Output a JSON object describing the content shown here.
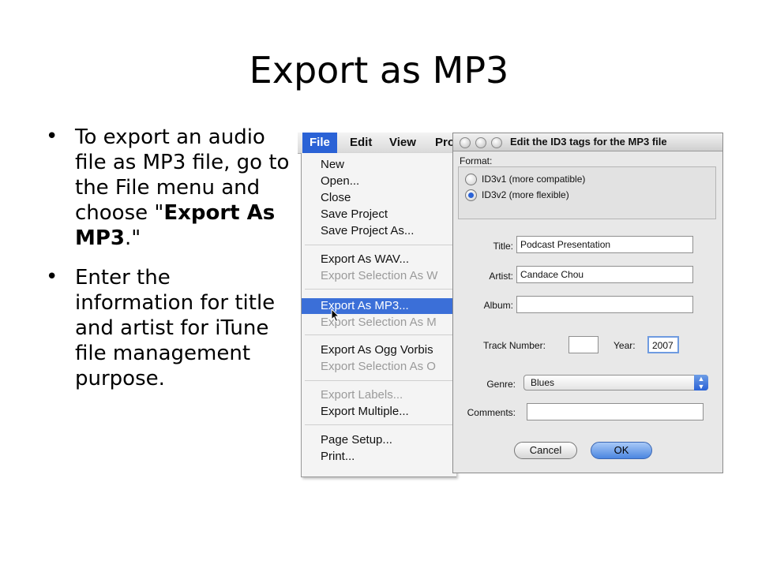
{
  "slide": {
    "title": "Export as MP3",
    "bullets": [
      {
        "text_before": "To export an audio file as MP3 file, go to the File menu and choose \"",
        "bold": "Export As MP3",
        "text_after": ".\""
      },
      {
        "text": "Enter the information for title and artist for iTune file management purpose."
      }
    ]
  },
  "menubar": {
    "items": [
      "File",
      "Edit",
      "View",
      "Pro"
    ],
    "active": "File"
  },
  "file_menu": {
    "items": [
      {
        "label": "New",
        "state": "enabled"
      },
      {
        "label": "Open...",
        "state": "enabled"
      },
      {
        "label": "Close",
        "state": "enabled"
      },
      {
        "label": "Save Project",
        "state": "enabled"
      },
      {
        "label": "Save Project As...",
        "state": "enabled"
      },
      {
        "label": "Export As WAV...",
        "state": "enabled"
      },
      {
        "label": "Export Selection As W",
        "state": "disabled"
      },
      {
        "label": "Export As MP3...",
        "state": "highlighted"
      },
      {
        "label": "Export Selection As M",
        "state": "disabled"
      },
      {
        "label": "Export As Ogg Vorbis",
        "state": "enabled"
      },
      {
        "label": "Export Selection As O",
        "state": "disabled"
      },
      {
        "label": "Export Labels...",
        "state": "disabled"
      },
      {
        "label": "Export Multiple...",
        "state": "enabled"
      },
      {
        "label": "Page Setup...",
        "state": "enabled"
      },
      {
        "label": "Print...",
        "state": "enabled"
      }
    ]
  },
  "dialog": {
    "title": "Edit the ID3 tags for the MP3 file",
    "format_label": "Format:",
    "format_options": [
      {
        "label": "ID3v1 (more compatible)",
        "selected": false
      },
      {
        "label": "ID3v2 (more flexible)",
        "selected": true
      }
    ],
    "title_label": "Title:",
    "title_value": "Podcast Presentation",
    "artist_label": "Artist:",
    "artist_value": "Candace Chou",
    "album_label": "Album:",
    "album_value": "",
    "track_label": "Track Number:",
    "track_value": "",
    "year_label": "Year:",
    "year_value": "2007",
    "genre_label": "Genre:",
    "genre_value": "Blues",
    "comments_label": "Comments:",
    "comments_value": "",
    "cancel_label": "Cancel",
    "ok_label": "OK"
  }
}
